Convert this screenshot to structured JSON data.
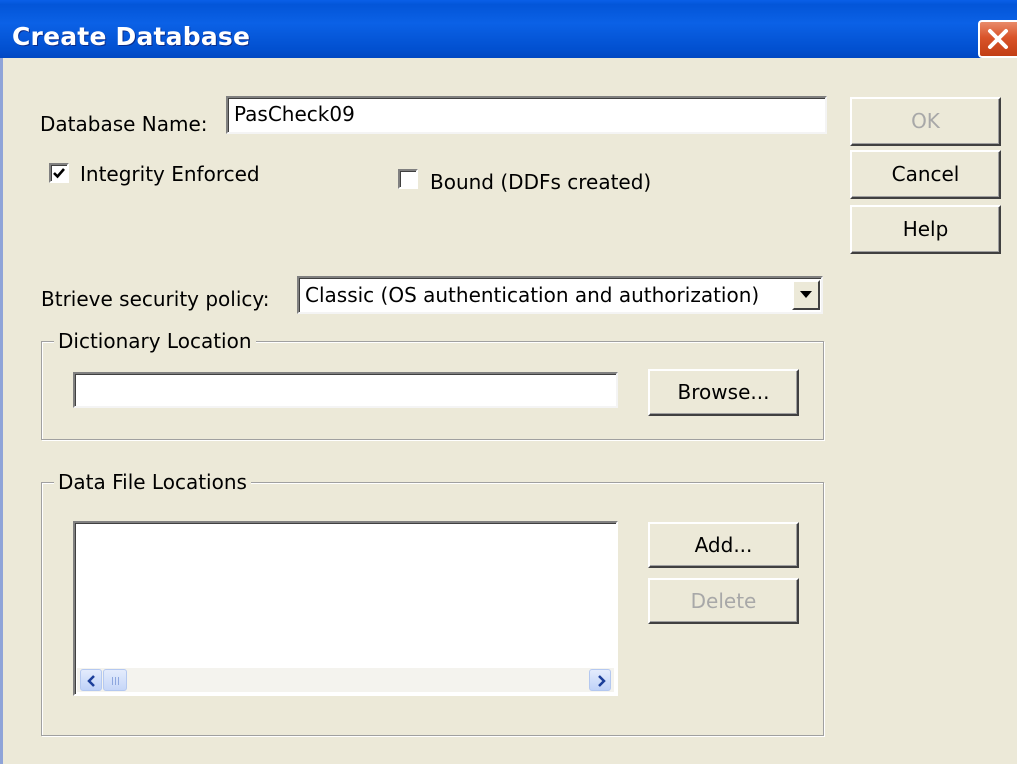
{
  "window": {
    "title": "Create Database"
  },
  "form": {
    "db_name_label": "Database Name:",
    "db_name_value": "PasCheck09",
    "integrity_label": "Integrity Enforced",
    "integrity_checked": true,
    "bound_label": "Bound (DDFs created)",
    "bound_checked": false,
    "security_label": "Btrieve security policy:",
    "security_value": "Classic (OS authentication and authorization)"
  },
  "dictionary": {
    "group_label": "Dictionary Location",
    "path_value": "",
    "browse_label": "Browse..."
  },
  "datafiles": {
    "group_label": "Data File Locations",
    "items": [],
    "add_label": "Add...",
    "delete_label": "Delete"
  },
  "buttons": {
    "ok": "OK",
    "cancel": "Cancel",
    "help": "Help"
  },
  "icons": {
    "close": "close-icon",
    "check": "checkmark-icon",
    "dropdown": "chevron-down-icon",
    "scroll_left": "arrow-left-icon",
    "scroll_right": "arrow-right-icon"
  },
  "colors": {
    "titlebar": "#0355d8",
    "dialog_bg": "#ece9d8",
    "close_button": "#d9542a",
    "disabled_text": "#a8a8a8"
  }
}
